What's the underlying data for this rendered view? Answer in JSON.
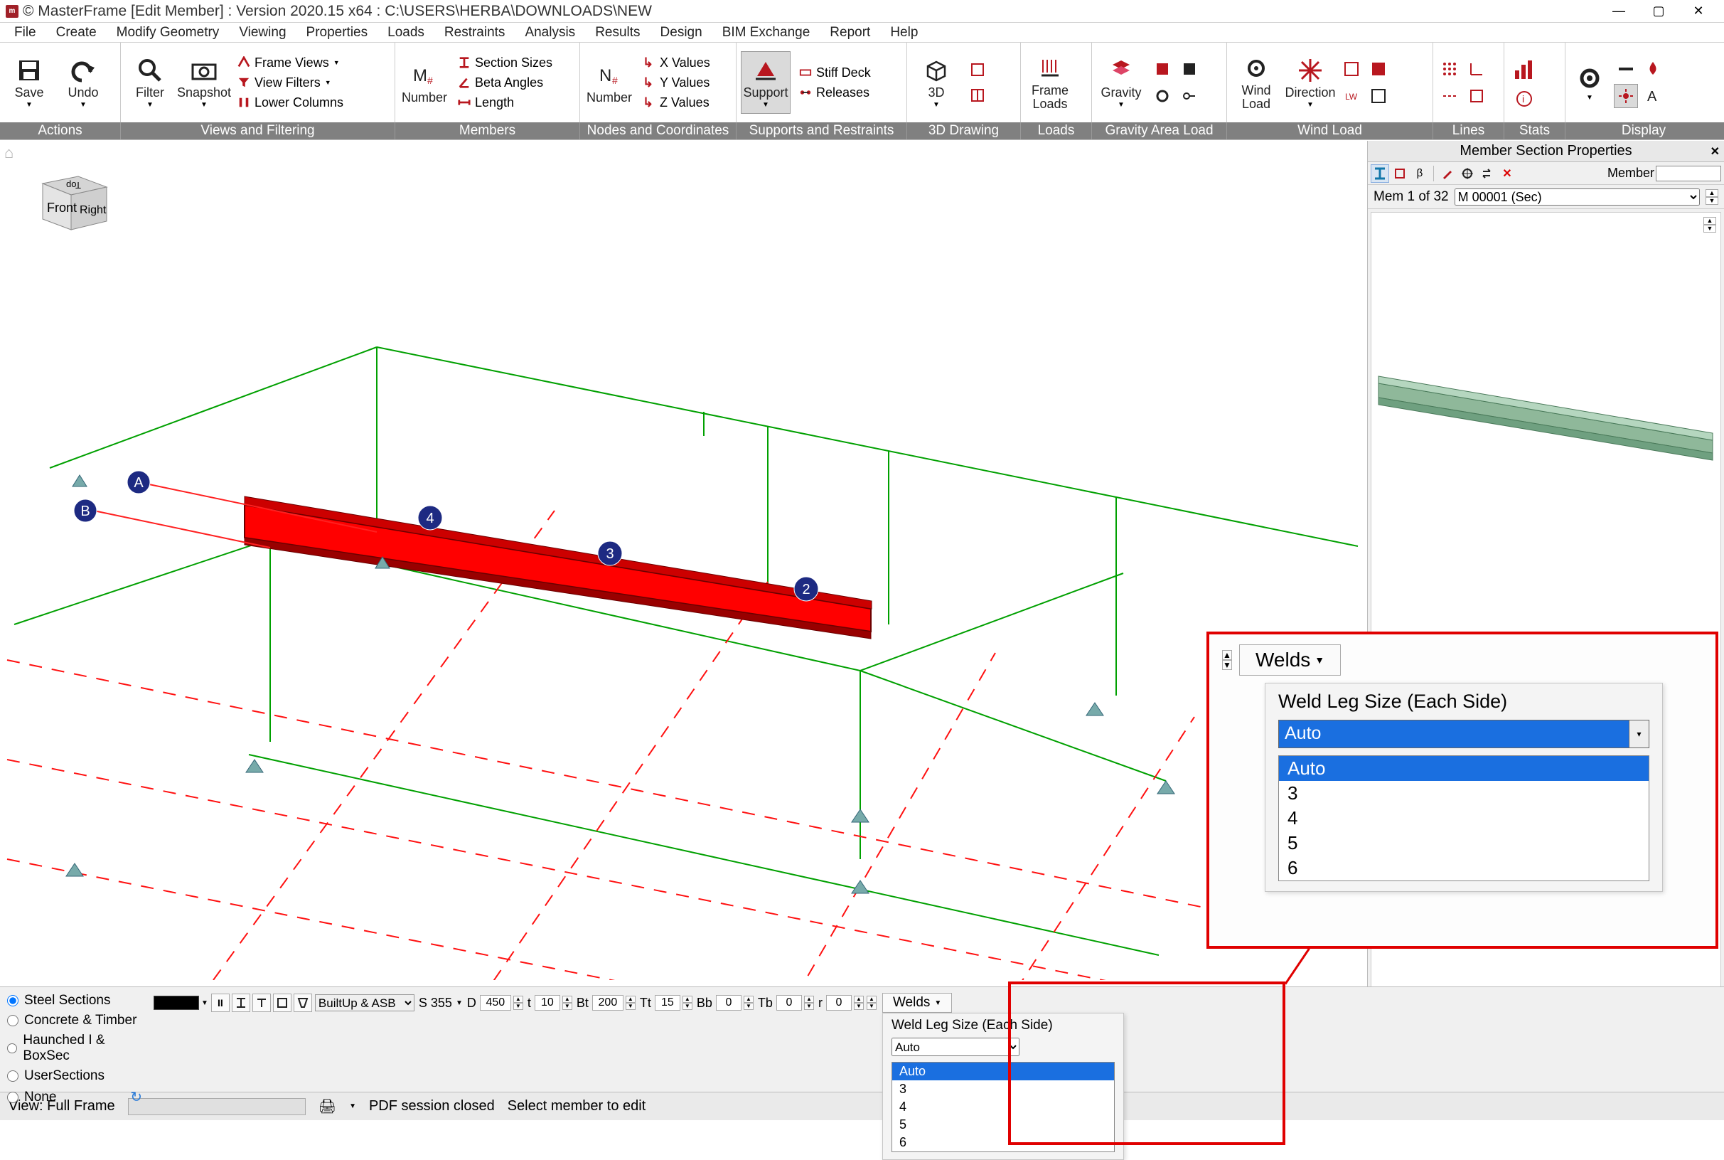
{
  "window": {
    "title": "© MasterFrame [Edit Member] : Version 2020.15 x64 : C:\\USERS\\HERBA\\DOWNLOADS\\NEW"
  },
  "menu": [
    "File",
    "Create",
    "Modify Geometry",
    "Viewing",
    "Properties",
    "Loads",
    "Restraints",
    "Analysis",
    "Results",
    "Design",
    "BIM Exchange",
    "Report",
    "Help"
  ],
  "ribbon": {
    "groups": [
      "Actions",
      "Views and Filtering",
      "Members",
      "Nodes and Coordinates",
      "Supports and Restraints",
      "3D Drawing",
      "Loads",
      "Gravity Area Load",
      "Wind Load",
      "Lines",
      "Stats",
      "Display"
    ],
    "actions_save": "Save",
    "actions_undo": "Undo",
    "views_filter": "Filter",
    "views_snapshot": "Snapshot",
    "views_frameviews": "Frame Views",
    "views_viewfilters": "View Filters",
    "views_lowercolumns": "Lower Columns",
    "members_number": "Number",
    "members_sectionsizes": "Section Sizes",
    "members_betaangles": "Beta Angles",
    "members_length": "Length",
    "nodes_number": "Number",
    "nodes_xvalues": "X Values",
    "nodes_yvalues": "Y Values",
    "nodes_zvalues": "Z Values",
    "supports_support": "Support",
    "supports_stiffdeck": "Stiff Deck",
    "supports_releases": "Releases",
    "drawing_3d": "3D",
    "loads_frameloads": "Frame\nLoads",
    "gravity_gravity": "Gravity",
    "wind_windload": "Wind\nLoad",
    "wind_direction": "Direction"
  },
  "props": {
    "title": "Member Section Properties",
    "member_label": "Member",
    "member_value": "",
    "counter": "Mem 1 of 32",
    "selected": "M 00001 (Sec)"
  },
  "cube": {
    "front": "Front",
    "right": "Right",
    "top": "Top"
  },
  "section": {
    "radios": [
      "Steel Sections",
      "Concrete & Timber",
      "Haunched I & BoxSec",
      "UserSections",
      "None"
    ],
    "radio_selected": 0,
    "category": "BuiltUp & ASB",
    "grade": "S 355",
    "D": "450",
    "t": "10",
    "Bt": "200",
    "Tt": "15",
    "Bb": "0",
    "Tb": "0",
    "r": "0",
    "welds_tab": "Welds",
    "welds_title": "Weld Leg Size (Each Side)",
    "welds_selected": "Auto",
    "welds_options": [
      "Auto",
      "3",
      "4",
      "5",
      "6"
    ]
  },
  "status": {
    "view": "View: Full Frame",
    "pdf": "PDF session closed",
    "hint": "Select member to edit"
  }
}
